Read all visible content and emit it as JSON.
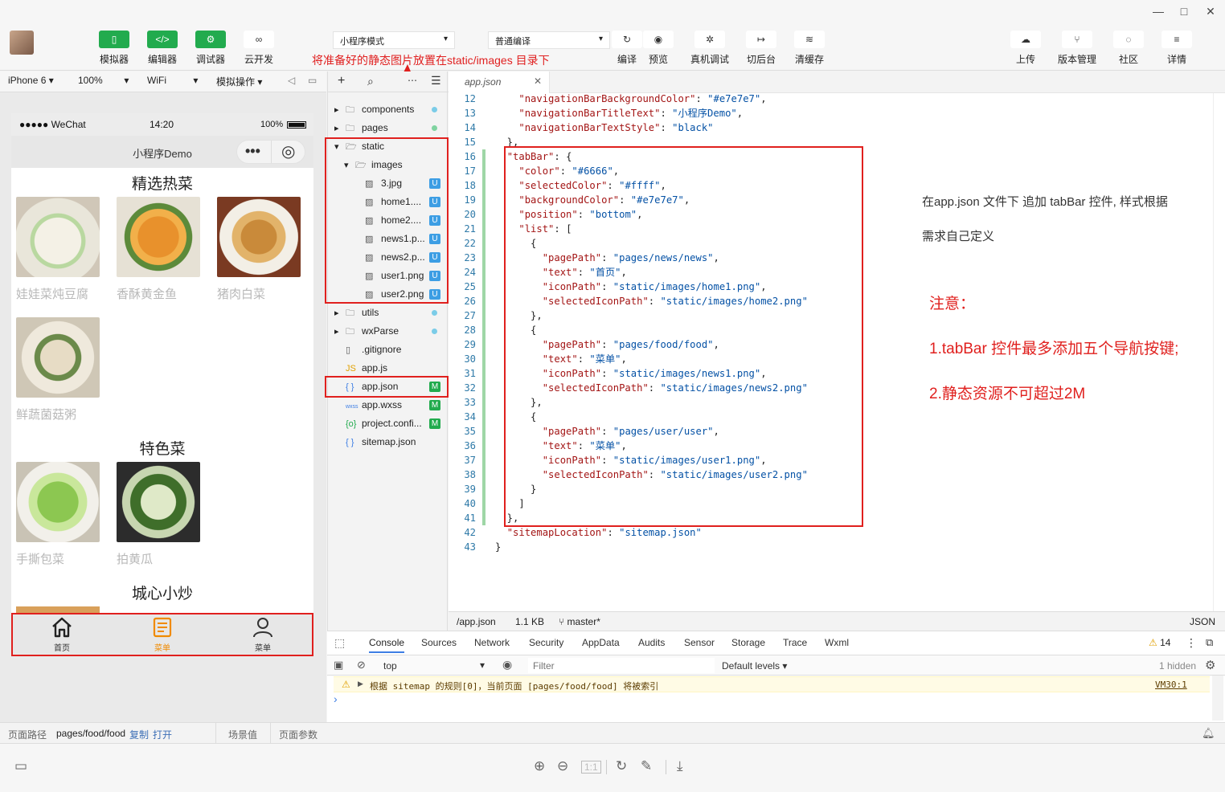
{
  "window": {
    "buttons": [
      "—",
      "□",
      "✕"
    ]
  },
  "toolbar": {
    "left_buttons": [
      {
        "label": "模拟器",
        "icon": "phone-icon",
        "glyph": "▯"
      },
      {
        "label": "编辑器",
        "icon": "code-icon",
        "glyph": "</>"
      },
      {
        "label": "调试器",
        "icon": "debug-icon",
        "glyph": "⚙"
      },
      {
        "label": "云开发",
        "icon": "cloud-link-icon",
        "glyph": "∞"
      }
    ],
    "mode_select": "小程序模式",
    "compile_select": "普通编译",
    "mid_buttons": [
      {
        "label": "编译",
        "icon": "refresh-icon",
        "glyph": "↻"
      },
      {
        "label": "预览",
        "icon": "eye-icon",
        "glyph": "◉"
      },
      {
        "label": "真机调试",
        "icon": "bug-icon",
        "glyph": "✲"
      },
      {
        "label": "切后台",
        "icon": "switch-icon",
        "glyph": "↦"
      },
      {
        "label": "清缓存",
        "icon": "layers-icon",
        "glyph": "≋"
      }
    ],
    "right_buttons": [
      {
        "label": "上传",
        "icon": "upload-cloud-icon",
        "glyph": "☁"
      },
      {
        "label": "版本管理",
        "icon": "branch-icon",
        "glyph": "⑂"
      },
      {
        "label": "社区",
        "icon": "chat-icon",
        "glyph": "◌"
      },
      {
        "label": "详情",
        "icon": "menu-icon",
        "glyph": "≡"
      }
    ]
  },
  "annotation_top": "将准备好的静态图片放置在static/images 目录下",
  "devbar": {
    "device": "iPhone 6",
    "zoom": "100%",
    "network": "WiFi",
    "operation": "模拟操作"
  },
  "phone": {
    "carrier": "●●●●● WeChat",
    "time": "14:20",
    "battery": "100%",
    "title": "小程序Demo",
    "capsule_more": "•••",
    "capsule_close": "◎",
    "sections": [
      {
        "title": "精选热菜",
        "items": [
          "娃娃菜炖豆腐",
          "香酥黄金鱼",
          "猪肉白菜",
          "鲜蔬菌菇粥"
        ]
      },
      {
        "title": "特色菜",
        "items": [
          "手撕包菜",
          "拍黄瓜"
        ]
      },
      {
        "title": "城心小炒",
        "items": []
      }
    ],
    "tabs": [
      {
        "label": "首页",
        "active": false
      },
      {
        "label": "菜单",
        "active": true
      },
      {
        "label": "菜单",
        "active": false
      }
    ],
    "active_color": "#f08a00"
  },
  "filetree": {
    "items": [
      {
        "name": "components",
        "type": "folder",
        "depth": 0,
        "open": false,
        "status": "dot"
      },
      {
        "name": "pages",
        "type": "folder",
        "depth": 0,
        "open": false,
        "status": "dot-green"
      },
      {
        "name": "static",
        "type": "folder",
        "depth": 0,
        "open": true,
        "status": ""
      },
      {
        "name": "images",
        "type": "folder",
        "depth": 1,
        "open": true,
        "status": ""
      },
      {
        "name": "3.jpg",
        "type": "img",
        "depth": 2,
        "status": "U"
      },
      {
        "name": "home1....",
        "type": "img",
        "depth": 2,
        "status": "U"
      },
      {
        "name": "home2....",
        "type": "img",
        "depth": 2,
        "status": "U"
      },
      {
        "name": "news1.p...",
        "type": "img",
        "depth": 2,
        "status": "U"
      },
      {
        "name": "news2.p...",
        "type": "img",
        "depth": 2,
        "status": "U"
      },
      {
        "name": "user1.png",
        "type": "img",
        "depth": 2,
        "status": "U"
      },
      {
        "name": "user2.png",
        "type": "img",
        "depth": 2,
        "status": "U"
      },
      {
        "name": "utils",
        "type": "folder",
        "depth": 0,
        "open": false,
        "status": "dot"
      },
      {
        "name": "wxParse",
        "type": "folder",
        "depth": 0,
        "open": false,
        "status": "dot"
      },
      {
        "name": ".gitignore",
        "type": "file",
        "depth": 0,
        "status": ""
      },
      {
        "name": "app.js",
        "type": "js",
        "depth": 0,
        "status": ""
      },
      {
        "name": "app.json",
        "type": "json",
        "depth": 0,
        "status": "M"
      },
      {
        "name": "app.wxss",
        "type": "wxss",
        "depth": 0,
        "status": "M"
      },
      {
        "name": "project.confi...",
        "type": "config",
        "depth": 0,
        "status": "M"
      },
      {
        "name": "sitemap.json",
        "type": "json",
        "depth": 0,
        "status": ""
      }
    ]
  },
  "editor": {
    "tab": "app.json",
    "lines": [
      {
        "n": 12,
        "t": "    \"navigationBarBackgroundColor\": \"#e7e7e7\","
      },
      {
        "n": 13,
        "t": "    \"navigationBarTitleText\": \"小程序Demo\","
      },
      {
        "n": 14,
        "t": "    \"navigationBarTextStyle\": \"black\""
      },
      {
        "n": 15,
        "t": "  },"
      },
      {
        "n": 16,
        "t": "  \"tabBar\": {"
      },
      {
        "n": 17,
        "t": "    \"color\": \"#6666\","
      },
      {
        "n": 18,
        "t": "    \"selectedColor\": \"#ffff\","
      },
      {
        "n": 19,
        "t": "    \"backgroundColor\": \"#e7e7e7\","
      },
      {
        "n": 20,
        "t": "    \"position\": \"bottom\","
      },
      {
        "n": 21,
        "t": "    \"list\": ["
      },
      {
        "n": 22,
        "t": "      {"
      },
      {
        "n": 23,
        "t": "        \"pagePath\": \"pages/news/news\","
      },
      {
        "n": 24,
        "t": "        \"text\": \"首页\","
      },
      {
        "n": 25,
        "t": "        \"iconPath\": \"static/images/home1.png\","
      },
      {
        "n": 26,
        "t": "        \"selectedIconPath\": \"static/images/home2.png\""
      },
      {
        "n": 27,
        "t": "      },"
      },
      {
        "n": 28,
        "t": "      {"
      },
      {
        "n": 29,
        "t": "        \"pagePath\": \"pages/food/food\","
      },
      {
        "n": 30,
        "t": "        \"text\": \"菜单\","
      },
      {
        "n": 31,
        "t": "        \"iconPath\": \"static/images/news1.png\","
      },
      {
        "n": 32,
        "t": "        \"selectedIconPath\": \"static/images/news2.png\""
      },
      {
        "n": 33,
        "t": "      },"
      },
      {
        "n": 34,
        "t": "      {"
      },
      {
        "n": 35,
        "t": "        \"pagePath\": \"pages/user/user\","
      },
      {
        "n": 36,
        "t": "        \"text\": \"菜单\","
      },
      {
        "n": 37,
        "t": "        \"iconPath\": \"static/images/user1.png\","
      },
      {
        "n": 38,
        "t": "        \"selectedIconPath\": \"static/images/user2.png\""
      },
      {
        "n": 39,
        "t": "      }"
      },
      {
        "n": 40,
        "t": "    ]"
      },
      {
        "n": 41,
        "t": "  },"
      },
      {
        "n": 42,
        "t": "  \"sitemapLocation\": \"sitemap.json\""
      },
      {
        "n": 43,
        "t": "}"
      }
    ],
    "note_line1": "在app.json 文件下 追加 tabBar 控件, 样式根据",
    "note_line2": "需求自己定义",
    "warn_title": "注意：",
    "warn_1": "1.tabBar 控件最多添加五个导航按键;",
    "warn_2": "2.静态资源不可超过2M"
  },
  "code_status": {
    "path": "/app.json",
    "size": "1.1 KB",
    "branch": "master*",
    "lang": "JSON"
  },
  "devtools": {
    "tabs": [
      "Console",
      "Sources",
      "Network",
      "Security",
      "AppData",
      "Audits",
      "Sensor",
      "Storage",
      "Trace",
      "Wxml"
    ],
    "warn_count": "14",
    "context": "top",
    "filter_placeholder": "Filter",
    "levels": "Default levels ▾",
    "hidden": "1 hidden",
    "message": "根据 sitemap 的规则[0]，当前页面 [pages/food/food] 将被索引",
    "message_src": "VM30:1",
    "prompt": "›"
  },
  "bottombar": {
    "path_label": "页面路径",
    "path": "pages/food/food",
    "copy": "复制",
    "open": "打开",
    "scene": "场景值",
    "params": "页面参数"
  },
  "colors": {
    "accent_green": "#22ab4e",
    "red_annotation": "#e0201e",
    "modified_badge": "#22ab4e",
    "untracked_badge": "#3d9ee4"
  }
}
